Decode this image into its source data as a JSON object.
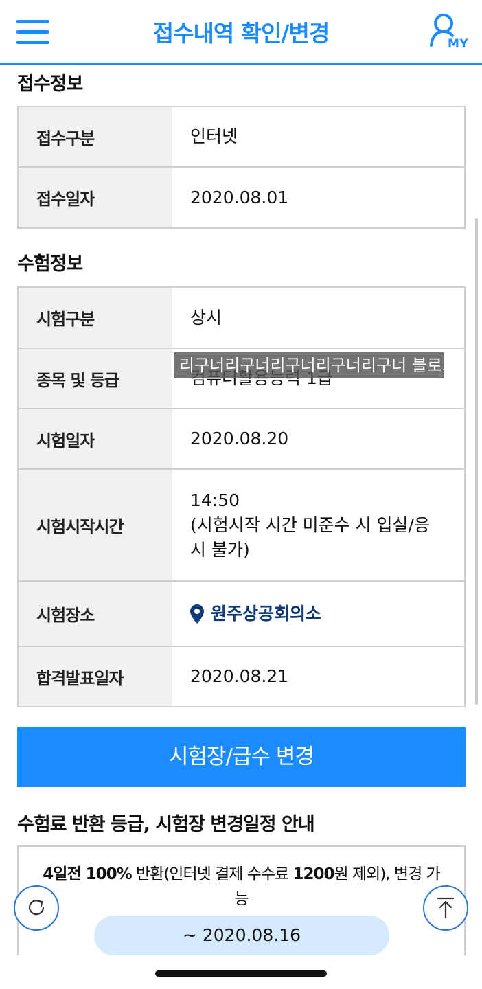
{
  "header": {
    "title": "접수내역 확인/변경",
    "my_label": "MY",
    "accent_color": "#1a8cff"
  },
  "reception": {
    "section_title": "접수정보",
    "rows": [
      {
        "label": "접수구분",
        "value": "인터넷"
      },
      {
        "label": "접수일자",
        "value": "2020.08.01"
      }
    ]
  },
  "exam": {
    "section_title": "수험정보",
    "rows": [
      {
        "label": "시험구분",
        "value": "상시"
      },
      {
        "label": "종목 및 등급",
        "value": "컴퓨터활용능력 1급"
      },
      {
        "label": "시험일자",
        "value": "2020.08.20"
      },
      {
        "label": "시험시작시간",
        "value": "14:50",
        "note": "(시험시작 시간 미준수 시 입실/응",
        "note2": "시 불가)"
      },
      {
        "label": "시험장소",
        "value": "원주상공회의소",
        "icon": "location-pin-icon"
      },
      {
        "label": "합격발표일자",
        "value": "2020.08.21"
      }
    ]
  },
  "watermark": "리구너리구너리구너리구너리구너 블로그",
  "change_button": "시험장/급수 변경",
  "notice": {
    "section_title": "수험료 반환 등급, 시험장 변경일정 안내",
    "t1": "4일전 ",
    "t2": "100%",
    "t3": " 반환(인터넷 결제 수수료 ",
    "t4": "1200",
    "t5": "원 제외), 변경 가",
    "t6": "능",
    "date_range": "~ 2020.08.16"
  },
  "icons": {
    "menu": "hamburger-menu-icon",
    "my": "user-icon",
    "refresh": "refresh-icon",
    "top": "arrow-up-icon"
  }
}
